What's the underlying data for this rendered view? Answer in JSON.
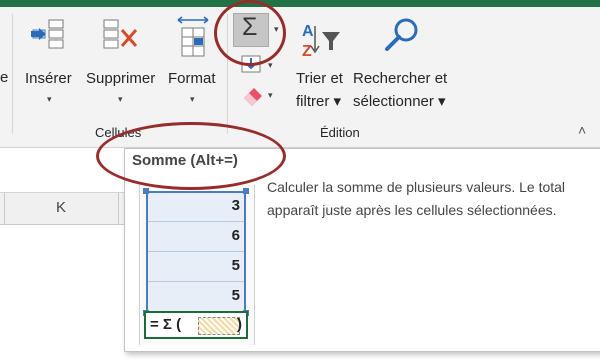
{
  "ribbon": {
    "cells_group": {
      "label": "Cellules",
      "insert_label": "Insérer",
      "delete_label": "Supprimer",
      "format_label": "Format",
      "caret": "▾"
    },
    "edit_group": {
      "label": "Édition",
      "autosum_symbol": "Σ",
      "sort_label_line1": "Trier et",
      "sort_label_line2": "filtrer ▾",
      "find_label_line1": "Rechercher et",
      "find_label_line2": "sélectionner ▾",
      "collapse_glyph": "˄"
    },
    "left_fragment": "e"
  },
  "sheet": {
    "column_header": "K"
  },
  "tooltip": {
    "title": "Somme (Alt+=)",
    "description": "Calculer la somme de plusieurs valeurs. Le total apparaît juste après les cellules sélectionnées.",
    "example_values": [
      "3",
      "6",
      "5",
      "5"
    ],
    "formula_prefix": "= Σ (",
    "formula_suffix": ")"
  },
  "colors": {
    "excel_green": "#217346",
    "annotation_red": "#962c2c",
    "selection_blue": "#4a7ebb",
    "sum_green": "#1e6b3a"
  }
}
